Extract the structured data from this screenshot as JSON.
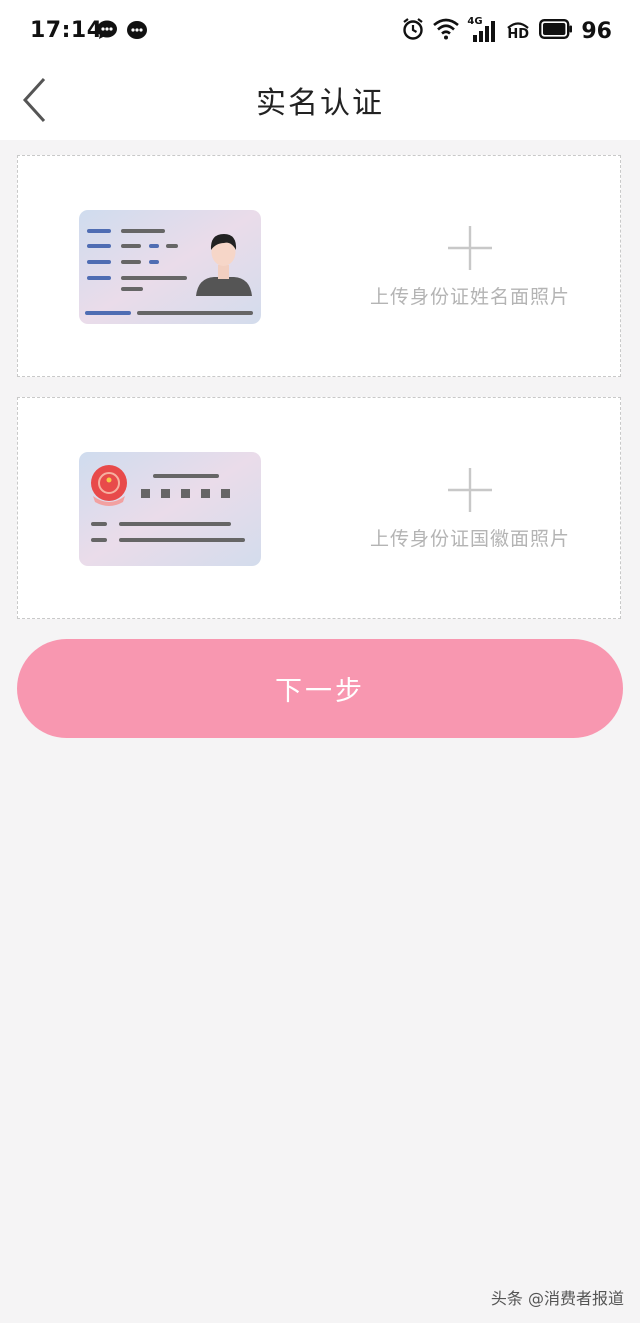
{
  "status_bar": {
    "time": "17:14",
    "battery": "96",
    "network": "4G",
    "hd": "HD"
  },
  "nav": {
    "title": "实名认证"
  },
  "cards": {
    "front_label": "上传身份证姓名面照片",
    "back_label": "上传身份证国徽面照片"
  },
  "actions": {
    "next_label": "下一步"
  },
  "watermark": "头条 @消费者报道",
  "colors": {
    "accent": "#f897b0",
    "card_bg": "#ffffff",
    "page_bg": "#f5f4f5",
    "hint_text": "#b4b4b4"
  }
}
